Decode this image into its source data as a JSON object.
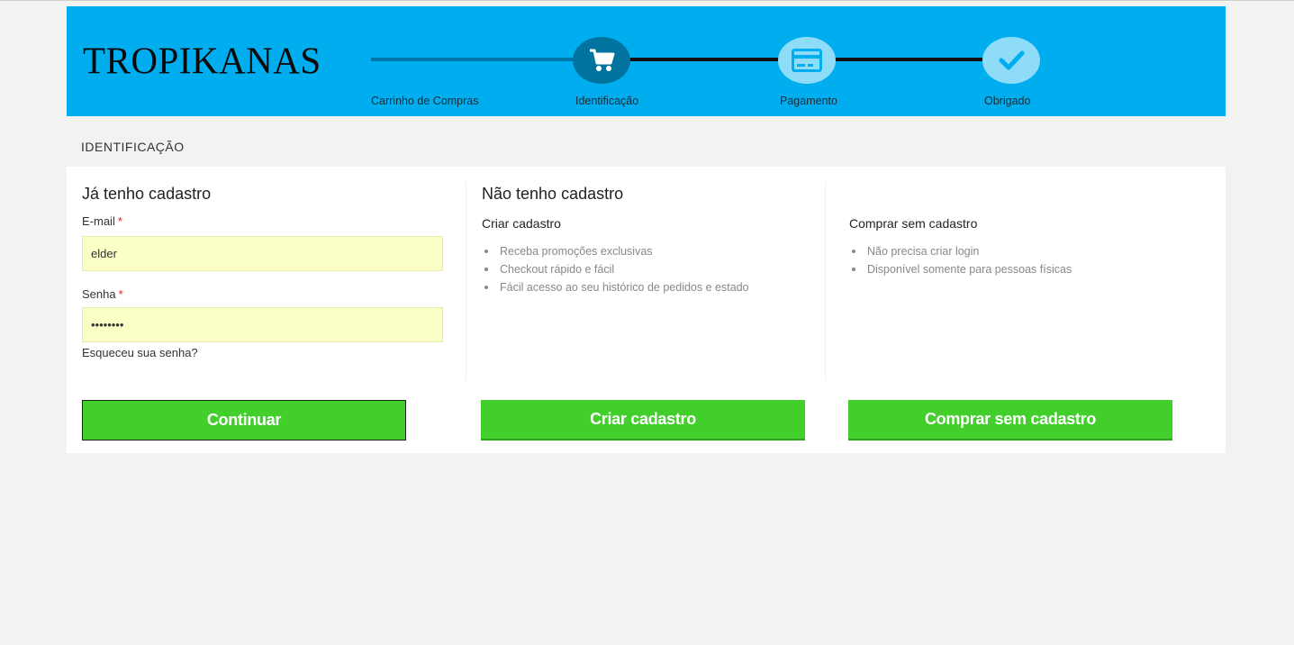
{
  "brand": {
    "logo": "TROPIKANAS"
  },
  "steps": [
    {
      "label": "Carrinho de Compras",
      "icon": "none",
      "state": "done"
    },
    {
      "label": "Identificação",
      "icon": "cart-icon",
      "state": "active"
    },
    {
      "label": "Pagamento",
      "icon": "credit-card-icon",
      "state": "pending"
    },
    {
      "label": "Obrigado",
      "icon": "check-icon",
      "state": "pending"
    }
  ],
  "section": {
    "title": "IDENTIFICAÇÃO"
  },
  "login": {
    "title": "Já tenho cadastro",
    "email_label": "E-mail",
    "email_value": "elder",
    "password_label": "Senha",
    "password_value": "password",
    "required_mark": "*",
    "forgot": "Esqueceu sua senha?",
    "button": "Continuar"
  },
  "register": {
    "title": "Não tenho cadastro",
    "subtitle": "Criar cadastro",
    "benefits": [
      "Receba promoções exclusivas",
      "Checkout rápido e fácil",
      "Fácil acesso ao seu histórico de pedidos e estado"
    ],
    "button": "Criar cadastro"
  },
  "guest": {
    "subtitle": "Comprar sem cadastro",
    "benefits": [
      "Não precisa criar login",
      "Disponível somente para pessoas físicas"
    ],
    "button": "Comprar sem cadastro"
  },
  "colors": {
    "header_bg": "#00aeef",
    "step_active": "#00739f",
    "step_pending": "#8fdcf8",
    "button_green": "#42cf2c",
    "input_autofill": "#fbffc6"
  }
}
